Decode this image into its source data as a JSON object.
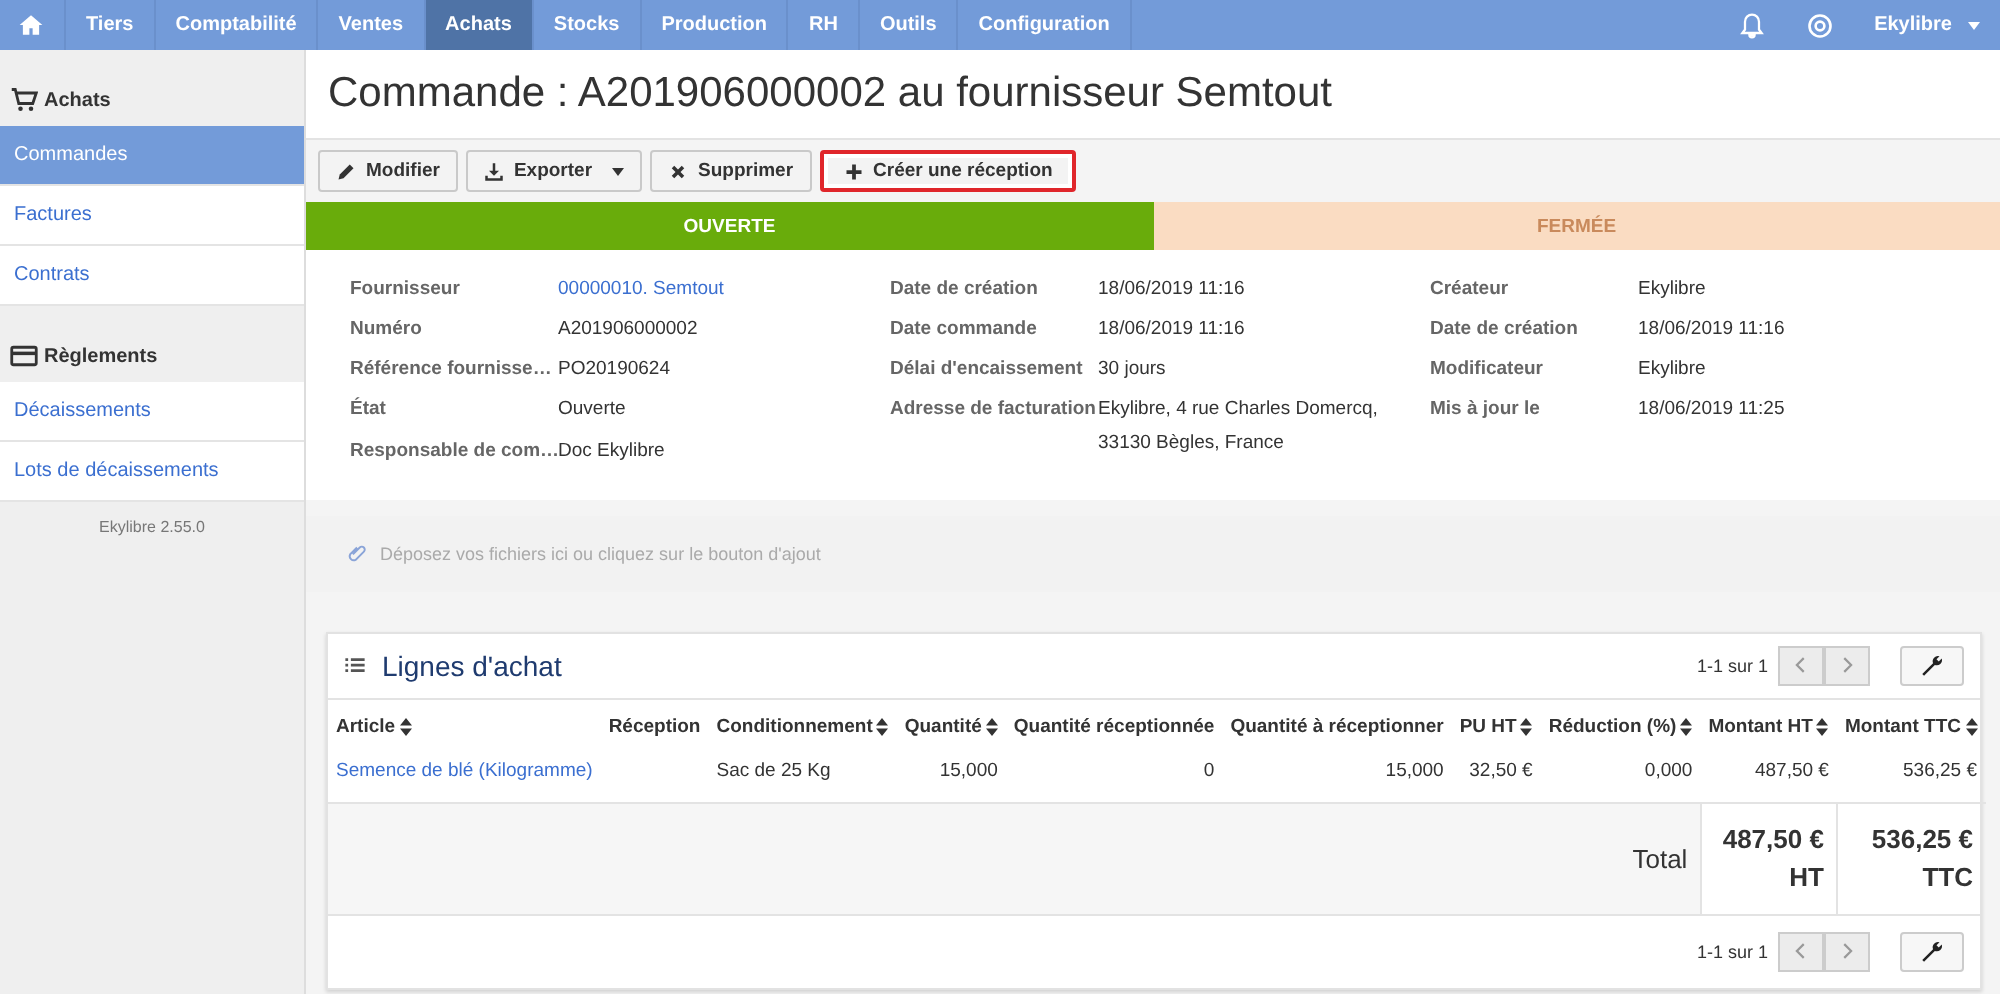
{
  "navbar": {
    "items": [
      {
        "label": "Tiers",
        "selected": false
      },
      {
        "label": "Comptabilité",
        "selected": false
      },
      {
        "label": "Ventes",
        "selected": false
      },
      {
        "label": "Achats",
        "selected": true
      },
      {
        "label": "Stocks",
        "selected": false
      },
      {
        "label": "Production",
        "selected": false
      },
      {
        "label": "RH",
        "selected": false
      },
      {
        "label": "Outils",
        "selected": false
      },
      {
        "label": "Configuration",
        "selected": false
      }
    ],
    "user": "Ekylibre"
  },
  "sidebar": {
    "sections": [
      {
        "title": "Achats",
        "items": [
          {
            "label": "Commandes",
            "selected": true
          },
          {
            "label": "Factures",
            "selected": false
          },
          {
            "label": "Contrats",
            "selected": false
          }
        ]
      },
      {
        "title": "Règlements",
        "items": [
          {
            "label": "Décaissements",
            "selected": false
          },
          {
            "label": "Lots de décaissements",
            "selected": false
          }
        ]
      }
    ],
    "version": "Ekylibre 2.55.0"
  },
  "page_title": "Commande : A201906000002 au fournisseur Semtout",
  "toolbar": [
    {
      "label": "Modifier",
      "highlighted": false,
      "dropdown": false
    },
    {
      "label": "Exporter",
      "highlighted": false,
      "dropdown": true
    },
    {
      "label": "Supprimer",
      "highlighted": false,
      "dropdown": false
    },
    {
      "label": "Créer une réception",
      "highlighted": true,
      "dropdown": false
    }
  ],
  "steps": [
    {
      "label": "OUVERTE",
      "selected": true
    },
    {
      "label": "FERMÉE",
      "selected": false
    }
  ],
  "details": [
    [
      {
        "label": "Fournisseur",
        "value": "00000010. Semtout",
        "link": true
      },
      {
        "label": "Numéro",
        "value": "A201906000002",
        "link": false
      },
      {
        "label": "Référence fournisse…",
        "value": "PO20190624"
      },
      {
        "label": "État",
        "value": "Ouverte"
      },
      {
        "label": "Responsable de com…",
        "value": "Doc Ekylibre"
      }
    ],
    [
      {
        "label": "Date de création",
        "value": "18/06/2019 11:16"
      },
      {
        "label": "Date commande",
        "value": "18/06/2019 11:16"
      },
      {
        "label": "Délai d'encaissement",
        "value": "30 jours"
      },
      {
        "label": "Adresse de facturation",
        "value": "Ekylibre, 4 rue Charles Domercq, 33130 Bègles, France"
      }
    ],
    [
      {
        "label": "Créateur",
        "value": "Ekylibre"
      },
      {
        "label": "Date de création",
        "value": "18/06/2019 11:16"
      },
      {
        "label": "Modificateur",
        "value": "Ekylibre"
      },
      {
        "label": "Mis à jour le",
        "value": "18/06/2019 11:25"
      }
    ]
  ],
  "dropzone": "Déposez vos fichiers ici ou cliquez sur le bouton d'ajout",
  "lines": {
    "title": "Lignes d'achat",
    "pagination_top": "1-1 sur 1",
    "pagination_bottom": "1-1 sur 1",
    "columns": [
      {
        "label": "Article",
        "sortable": true
      },
      {
        "label": "Réception",
        "sortable": false
      },
      {
        "label": "Conditionnement",
        "sortable": true
      },
      {
        "label": "Quantité",
        "sortable": true
      },
      {
        "label": "Quantité réceptionnée",
        "sortable": false
      },
      {
        "label": "Quantité à réceptionner",
        "sortable": false
      },
      {
        "label": "PU HT",
        "sortable": true
      },
      {
        "label": "Réduction (%)",
        "sortable": true
      },
      {
        "label": "Montant HT",
        "sortable": true
      },
      {
        "label": "Montant TTC",
        "sortable": true
      }
    ],
    "rows": [
      [
        "Semence de blé (Kilogramme)",
        "",
        "Sac de 25 Kg",
        "15,000",
        "0",
        "15,000",
        "32,50 €",
        "0,000",
        "487,50 €",
        "536,25 €"
      ]
    ],
    "total_label": "Total",
    "total_ht": "487,50 € HT",
    "total_ttc": "536,25 € TTC"
  }
}
